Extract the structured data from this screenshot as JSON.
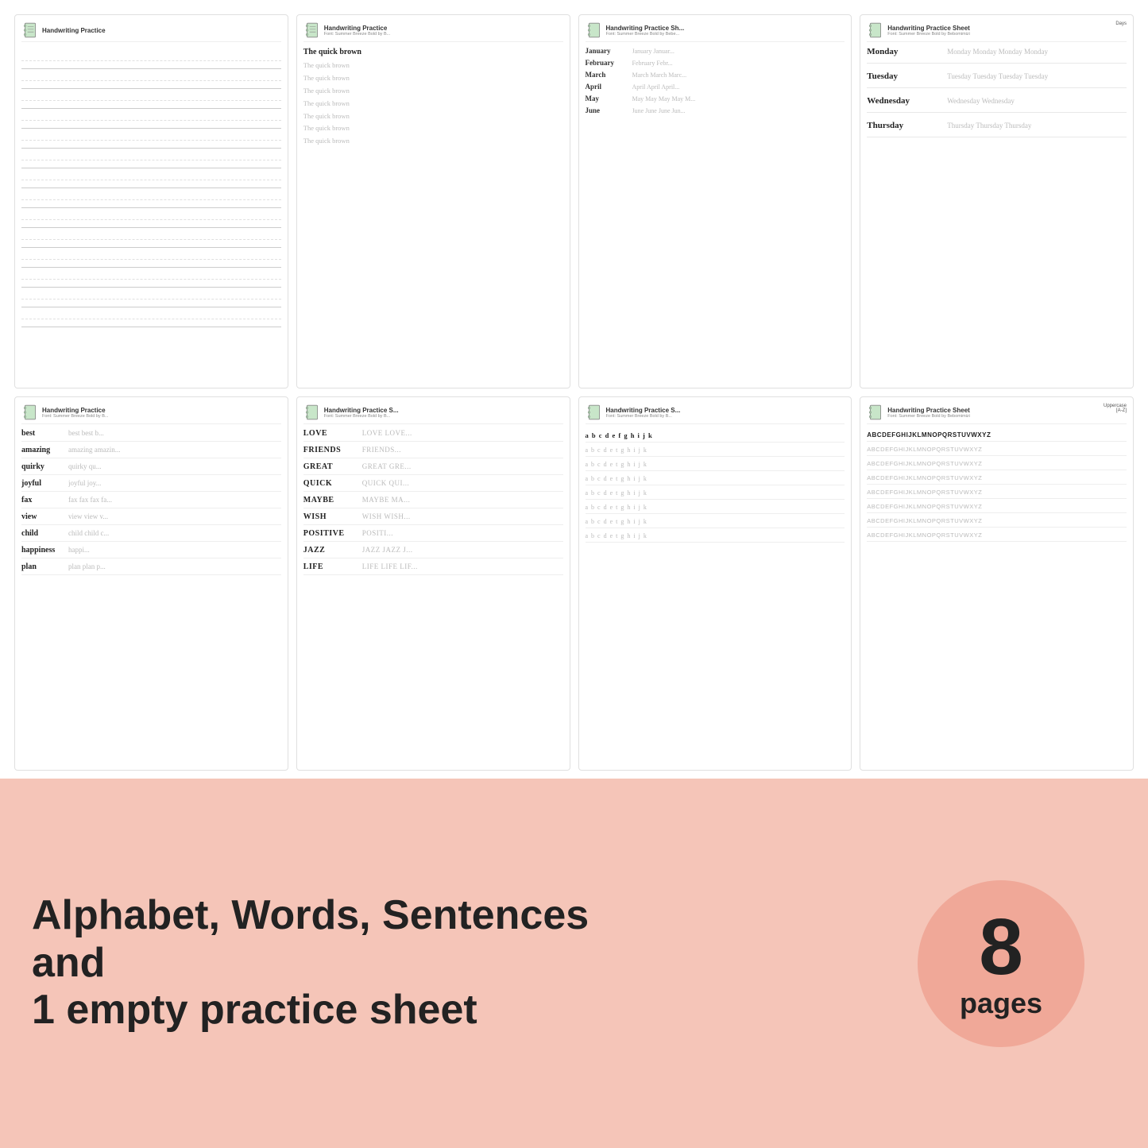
{
  "sheets": {
    "row1": [
      {
        "id": "sheet1",
        "title": "Handwriting Practice",
        "subtitle": "",
        "tag": "",
        "type": "empty-lines"
      },
      {
        "id": "sheet2",
        "title": "Handwriting Practice",
        "subtitle": "Font: Summer Breeze Bold by B...",
        "tag": "",
        "type": "sentences",
        "lines": [
          "The quick brown",
          "The quick brown",
          "The quick brown",
          "The quick brown",
          "The quick brown",
          "The quick brown",
          "The quick brown",
          "The quick brown"
        ]
      },
      {
        "id": "sheet3",
        "title": "Handwriting Practice Sh...",
        "subtitle": "Font: Summer Breeze Bold by Bebe...",
        "tag": "",
        "type": "months",
        "months": [
          "January",
          "February",
          "March",
          "April",
          "May",
          "June"
        ]
      },
      {
        "id": "sheet4",
        "title": "Handwriting Practice Sheet",
        "subtitle": "Font: Summer Breeze Bold by Bebomimizi",
        "tag": "Days",
        "type": "days",
        "days": [
          "Monday",
          "Tuesday",
          "Wednesday",
          "Thursday"
        ]
      }
    ],
    "row2": [
      {
        "id": "sheet5",
        "title": "Handwriting Practice",
        "subtitle": "Font: Summer Breeze Bold by B...",
        "tag": "",
        "type": "words",
        "words": [
          "best",
          "amazing",
          "quirky",
          "joyful",
          "fax",
          "view",
          "child",
          "happiness",
          "plan"
        ]
      },
      {
        "id": "sheet6",
        "title": "Handwriting Practice S...",
        "subtitle": "Font: Summer Breeze Bold by B...",
        "tag": "",
        "type": "uppercase-words",
        "words": [
          "LOVE",
          "FRIENDS",
          "GREAT",
          "QUICK",
          "MAYBE",
          "WISH",
          "POSITIVE",
          "JAZZ",
          "LIFE"
        ]
      },
      {
        "id": "sheet7",
        "title": "Handwriting Practice S...",
        "subtitle": "Font: Summer Breeze Bold by B...",
        "tag": "",
        "type": "lowercase-alpha",
        "alpha": "abcdefghijk"
      },
      {
        "id": "sheet8",
        "title": "Handwriting Practice Sheet",
        "subtitle": "Font: Summer Breeze Bold by Bebomimizi",
        "tag": "Uppercase\n[A-Z]",
        "type": "uppercase-alpha",
        "alpha": "ABCDEFGHIJKLMNOPQRSTUVWXYZ"
      }
    ]
  },
  "bottom": {
    "text": "Alphabet, Words, Sentences and\n1 empty practice sheet",
    "badge_number": "8",
    "badge_label": "pages"
  }
}
